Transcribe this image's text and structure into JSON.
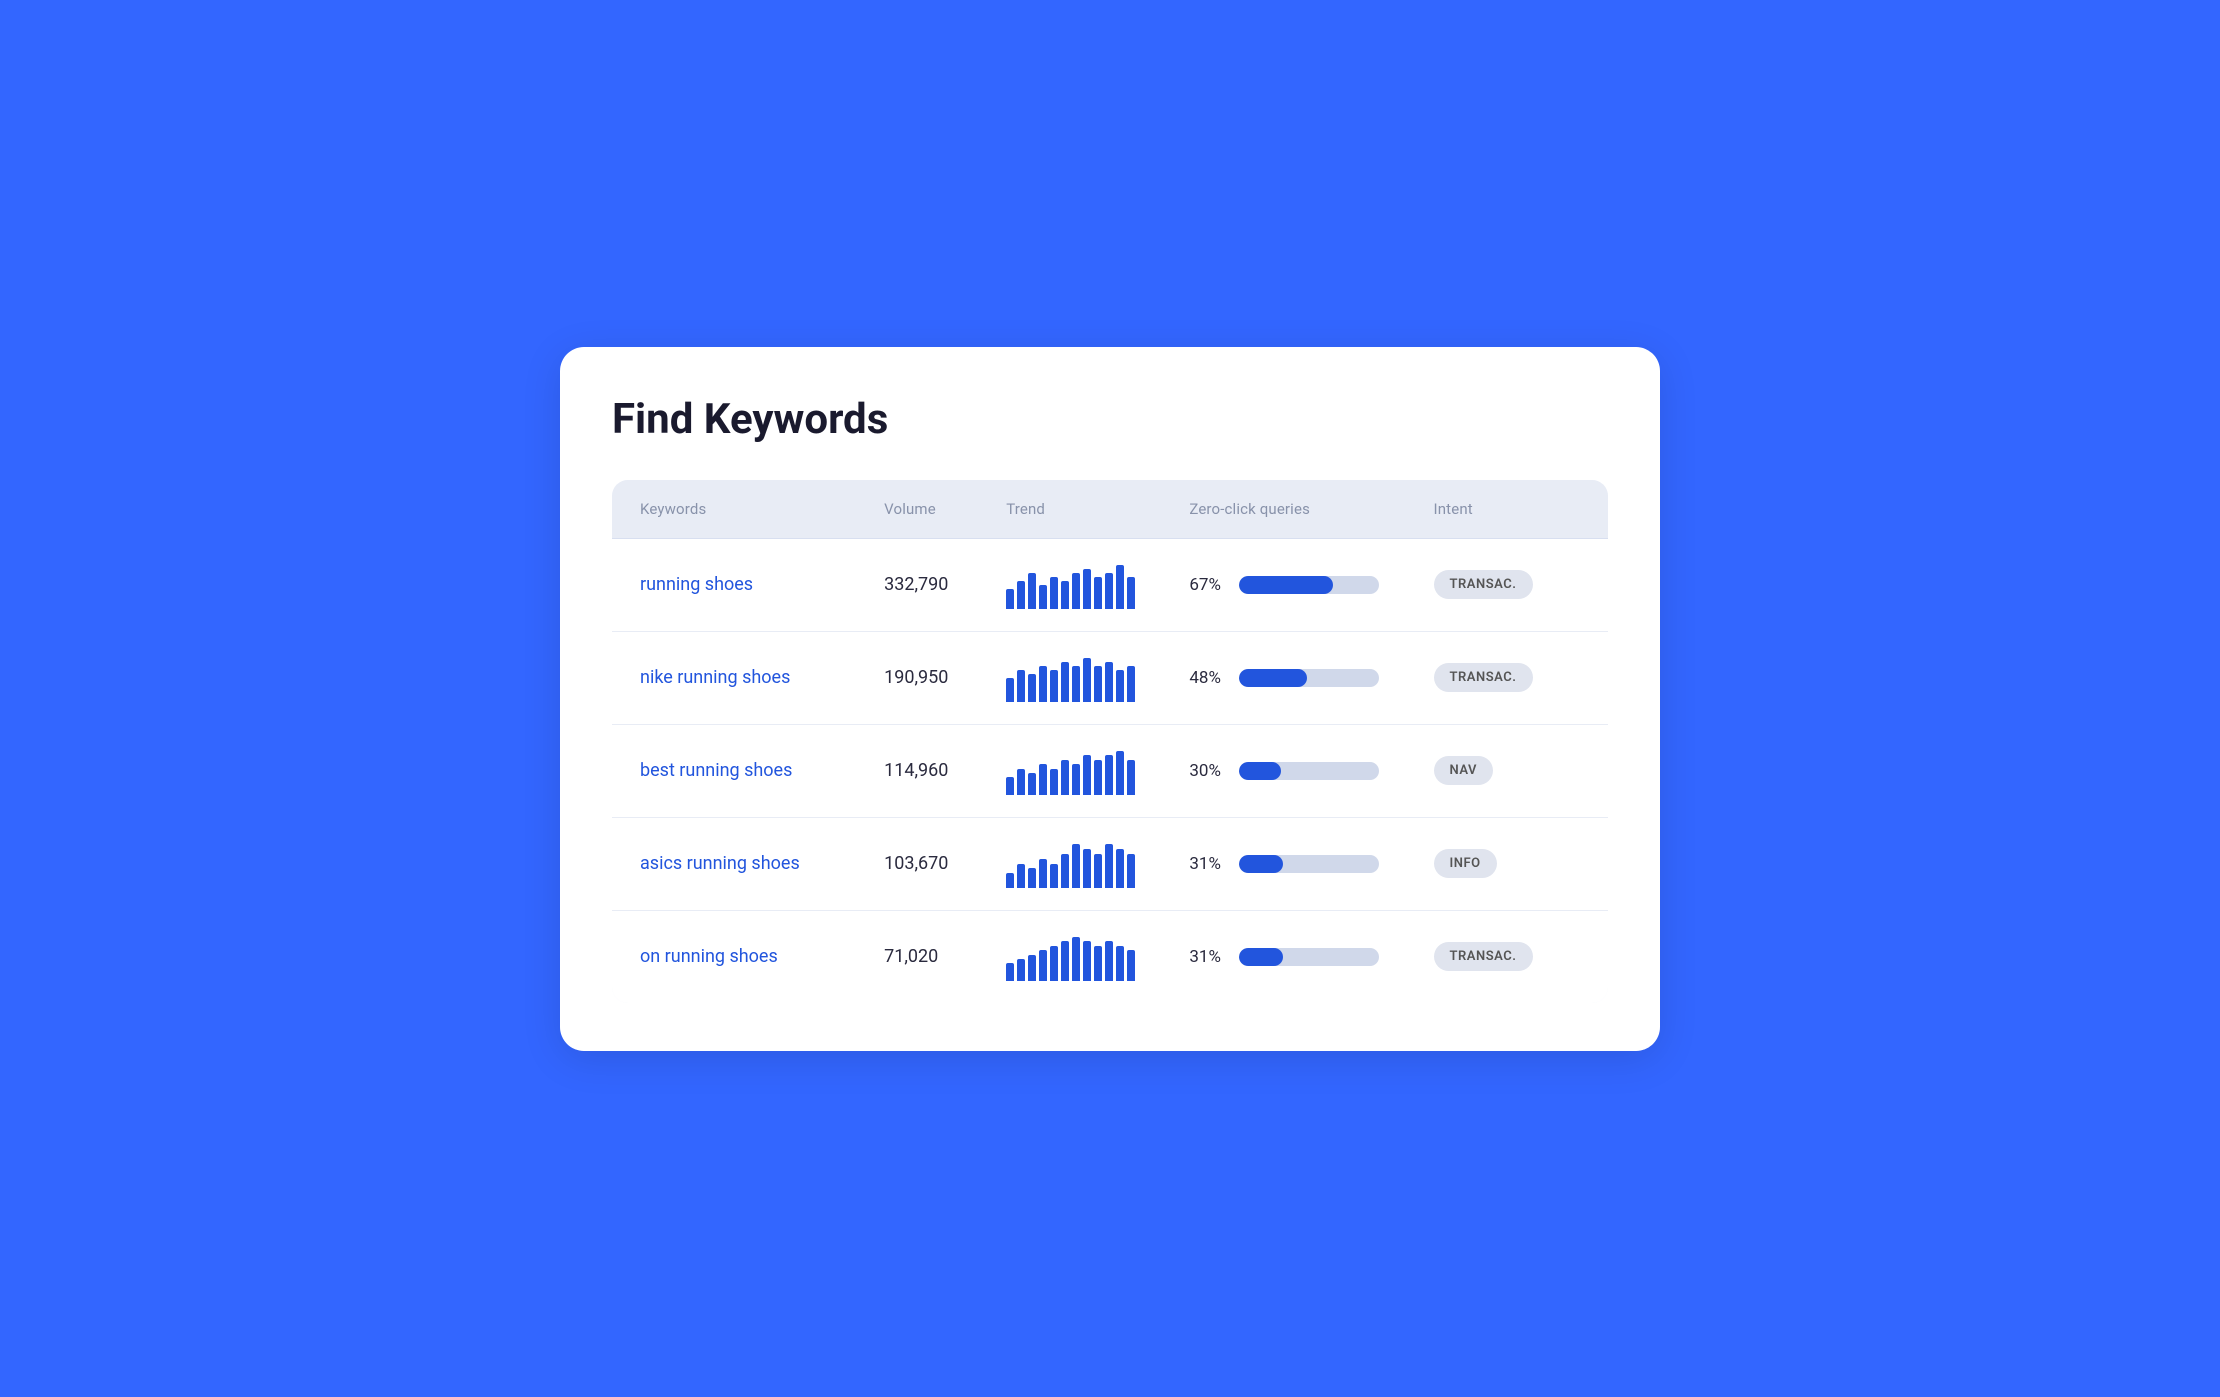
{
  "page": {
    "title": "Find Keywords"
  },
  "table": {
    "headers": {
      "keyword": "Keywords",
      "volume": "Volume",
      "trend": "Trend",
      "zero_click": "Zero-click queries",
      "intent": "Intent"
    },
    "rows": [
      {
        "keyword": "running shoes",
        "volume": "332,790",
        "zero_click_pct": "67%",
        "zero_click_val": 67,
        "intent": "TRANSAC.",
        "trend_bars": [
          5,
          7,
          9,
          6,
          8,
          7,
          9,
          10,
          8,
          9,
          11,
          8
        ]
      },
      {
        "keyword": "nike running shoes",
        "volume": "190,950",
        "zero_click_pct": "48%",
        "zero_click_val": 48,
        "intent": "TRANSAC.",
        "trend_bars": [
          6,
          8,
          7,
          9,
          8,
          10,
          9,
          11,
          9,
          10,
          8,
          9
        ]
      },
      {
        "keyword": "best running shoes",
        "volume": "114,960",
        "zero_click_pct": "30%",
        "zero_click_val": 30,
        "intent": "NAV",
        "trend_bars": [
          4,
          6,
          5,
          7,
          6,
          8,
          7,
          9,
          8,
          9,
          10,
          8
        ]
      },
      {
        "keyword": "asics running shoes",
        "volume": "103,670",
        "zero_click_pct": "31%",
        "zero_click_val": 31,
        "intent": "INFO",
        "trend_bars": [
          3,
          5,
          4,
          6,
          5,
          7,
          9,
          8,
          7,
          9,
          8,
          7
        ]
      },
      {
        "keyword": "on running shoes",
        "volume": "71,020",
        "zero_click_pct": "31%",
        "zero_click_val": 31,
        "intent": "TRANSAC.",
        "trend_bars": [
          4,
          5,
          6,
          7,
          8,
          9,
          10,
          9,
          8,
          9,
          8,
          7
        ]
      }
    ]
  }
}
